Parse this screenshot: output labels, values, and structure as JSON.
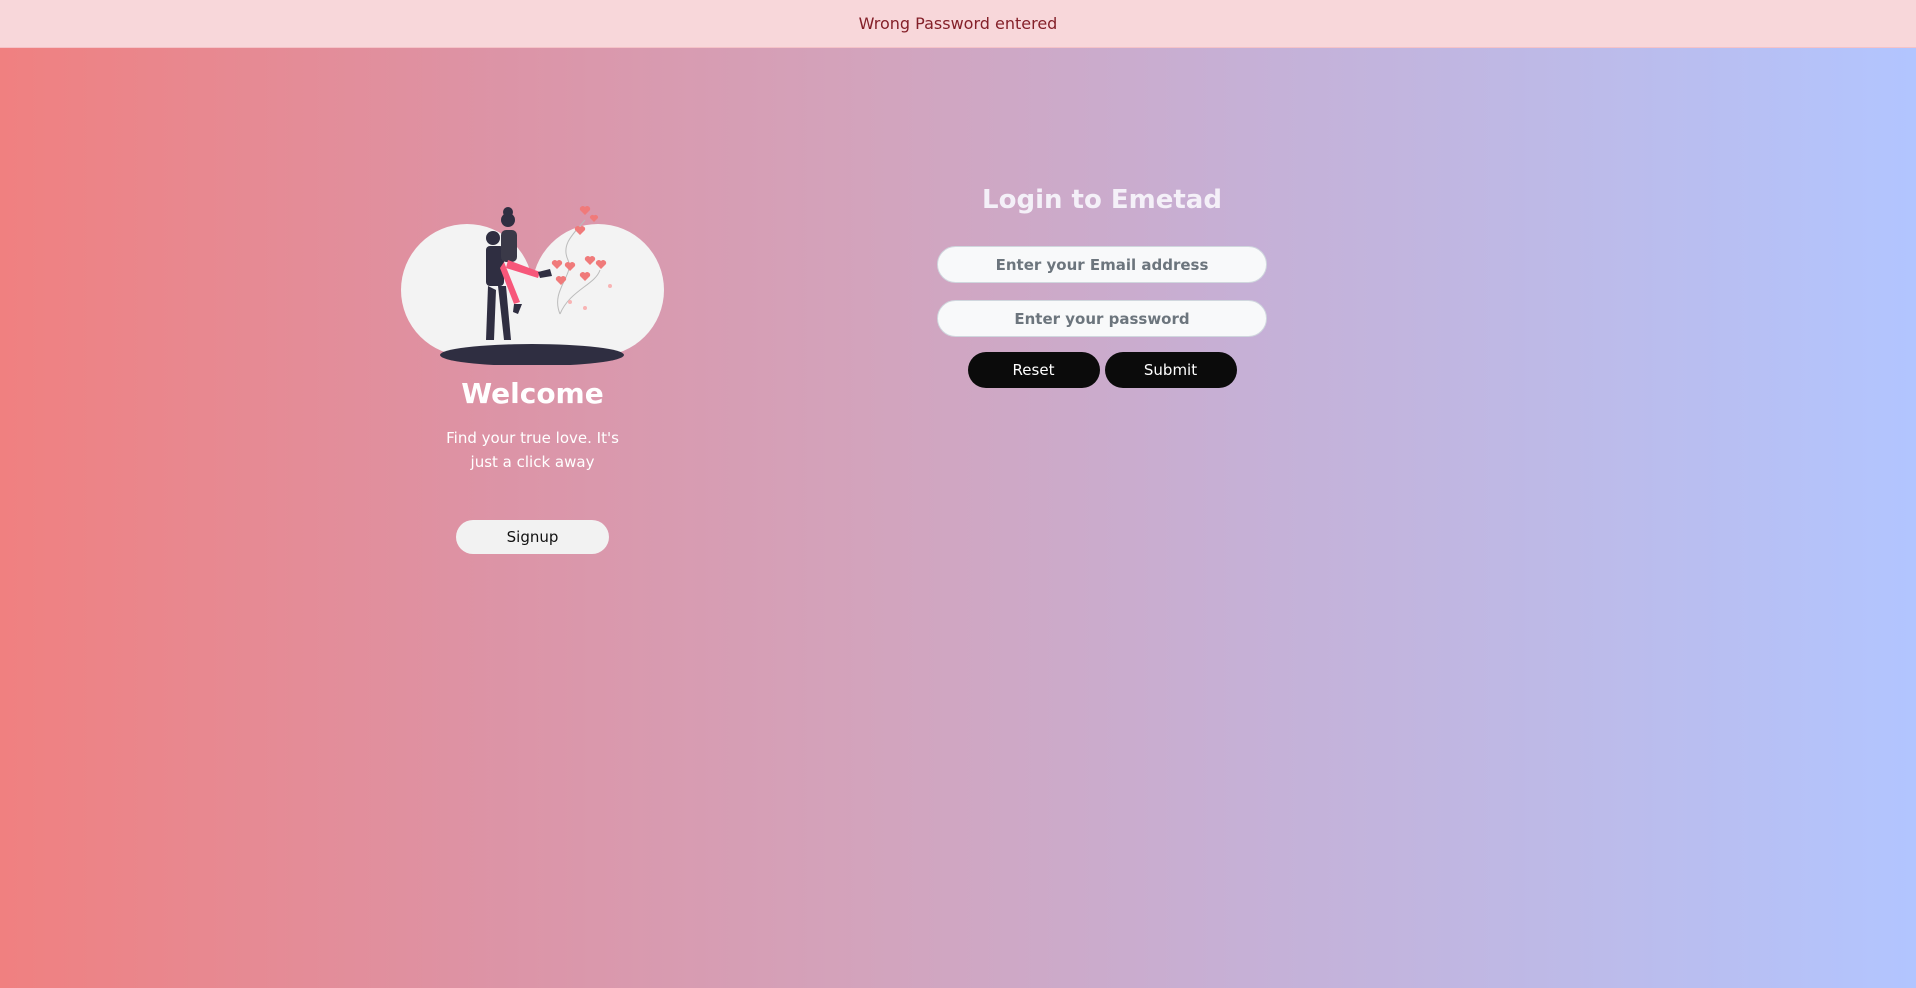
{
  "alert": {
    "message": "Wrong Password entered"
  },
  "welcome_panel": {
    "illustration": "couple-hugging-with-heart-balloons",
    "heading": "Welcome",
    "tagline": "Find your true love. It's just a click away",
    "signup_label": "Signup"
  },
  "login": {
    "title": "Login to Emetad",
    "email_placeholder": "Enter your Email address",
    "email_value": "",
    "password_placeholder": "Enter your password",
    "password_value": "",
    "reset_label": "Reset",
    "submit_label": "Submit"
  },
  "colors": {
    "gradient_start": "#f08080",
    "gradient_end": "#b2c5ff",
    "alert_background": "#f8d7da",
    "alert_text": "#842029",
    "button_dark": "#0b0b0b",
    "heart_accent": "#f07a7a"
  }
}
